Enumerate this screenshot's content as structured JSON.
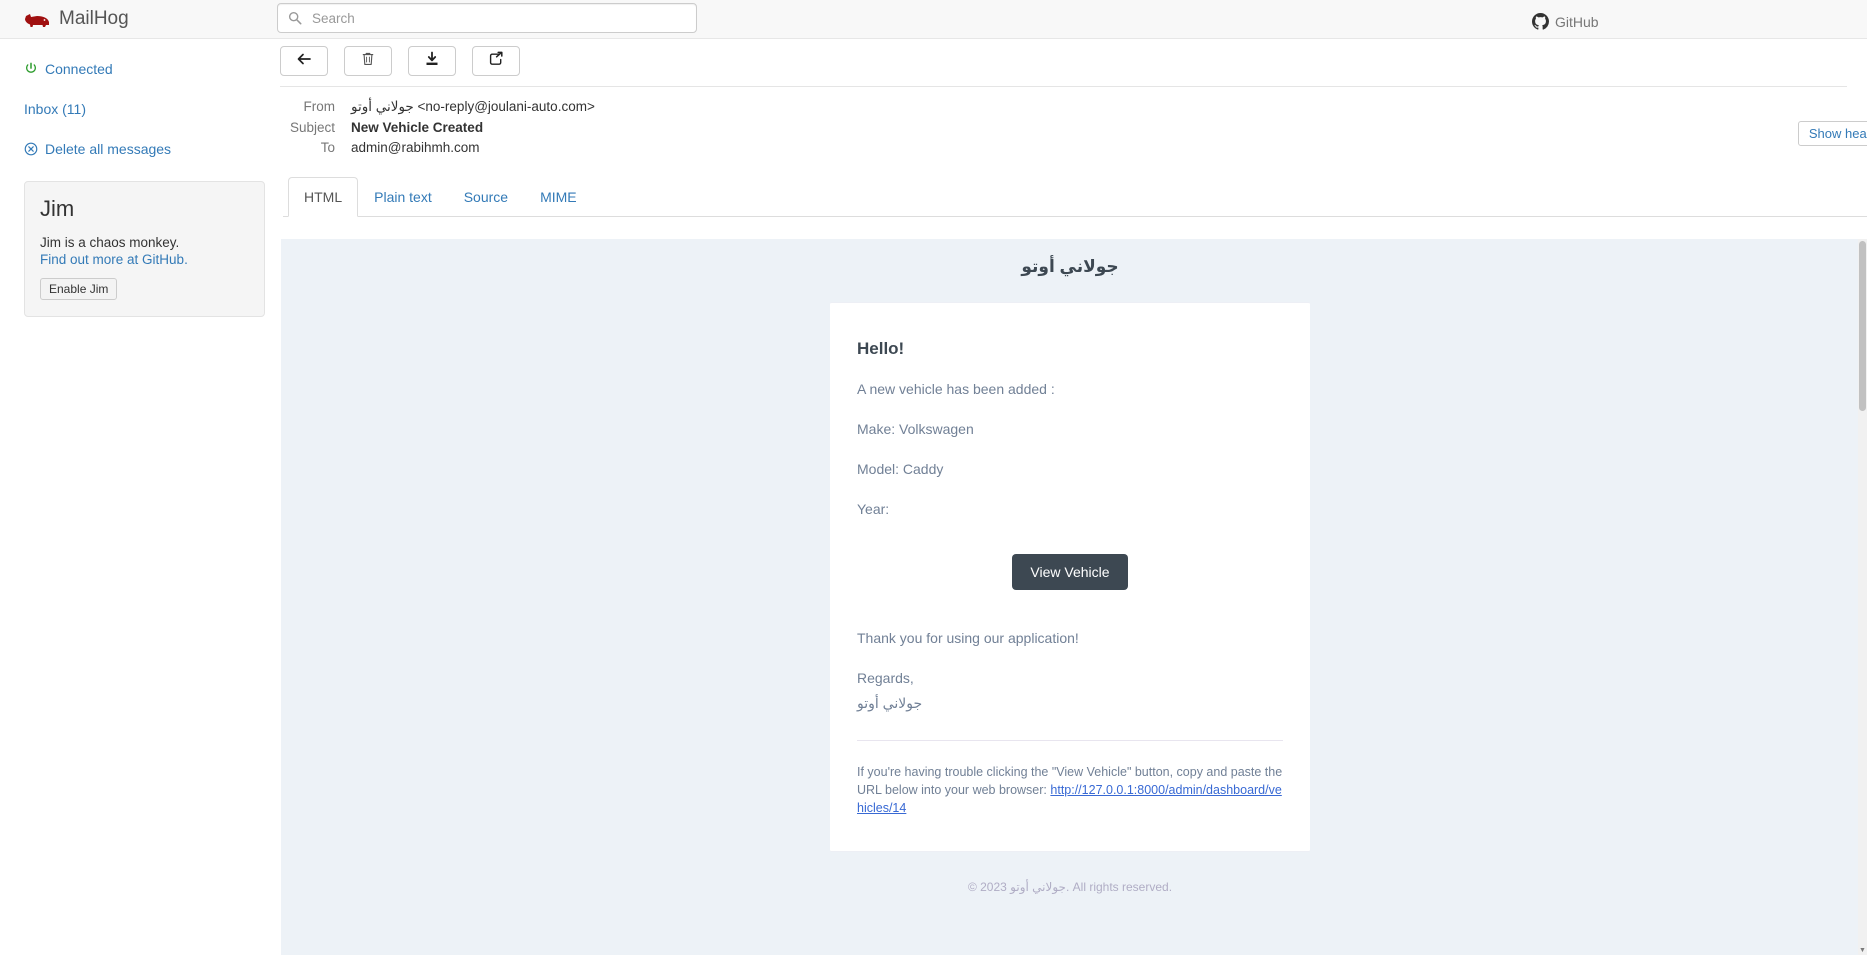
{
  "app": {
    "brand": "MailHog",
    "brand_icon": "hog-icon",
    "github_label": "GitHub"
  },
  "search": {
    "placeholder": "Search",
    "value": "",
    "icon": "search-icon"
  },
  "sidebar": {
    "links": [
      {
        "label": "Connected",
        "icon": "power-icon"
      },
      {
        "label": "Inbox (11)",
        "icon": "none"
      },
      {
        "label": "Delete all messages",
        "icon": "delete-circle-icon"
      }
    ],
    "jim": {
      "title": "Jim",
      "description": "Jim is a chaos monkey.",
      "link": "Find out more at GitHub.",
      "button": "Enable Jim"
    }
  },
  "toolbar": {
    "buttons": [
      {
        "name": "back-button",
        "icon": "arrow-left-icon"
      },
      {
        "name": "delete-button",
        "icon": "trash-icon"
      },
      {
        "name": "download-button",
        "icon": "download-icon"
      },
      {
        "name": "release-button",
        "icon": "release-icon"
      }
    ],
    "show_headers": "Show headers"
  },
  "message": {
    "fields": [
      {
        "label": "From",
        "value": "جولاني أوتو <no-reply@joulani-auto.com>"
      },
      {
        "label": "Subject",
        "value": "New Vehicle Created"
      },
      {
        "label": "To",
        "value": "admin@rabihmh.com"
      }
    ],
    "tabs": [
      {
        "label": "HTML",
        "active": true
      },
      {
        "label": "Plain text",
        "active": false
      },
      {
        "label": "Source",
        "active": false
      },
      {
        "label": "MIME",
        "active": false
      }
    ]
  },
  "email": {
    "brand_header": "جولاني أوتو",
    "greeting": "Hello!",
    "intro": "A new vehicle has been added :",
    "make_line": "Make: Volkswagen",
    "model_line": "Model: Caddy",
    "year_line": "Year:",
    "cta_label": "View Vehicle",
    "thanks": "Thank you for using our application!",
    "regards": "Regards,",
    "signature": "جولاني أوتو",
    "subcopy_text": "If you're having trouble clicking the \"View Vehicle\" button, copy and paste the URL below into your web browser:",
    "subcopy_url": "http://127.0.0.1:8000/admin/dashboard/vehicles/14",
    "footer": "© 2023 جولاني أوتو. All rights reserved."
  },
  "colors": {
    "link": "#337ab7",
    "email_bg": "#edf2f7",
    "button_bg": "#3d4852",
    "email_link": "#3869d4",
    "brand_red": "#a01010"
  }
}
